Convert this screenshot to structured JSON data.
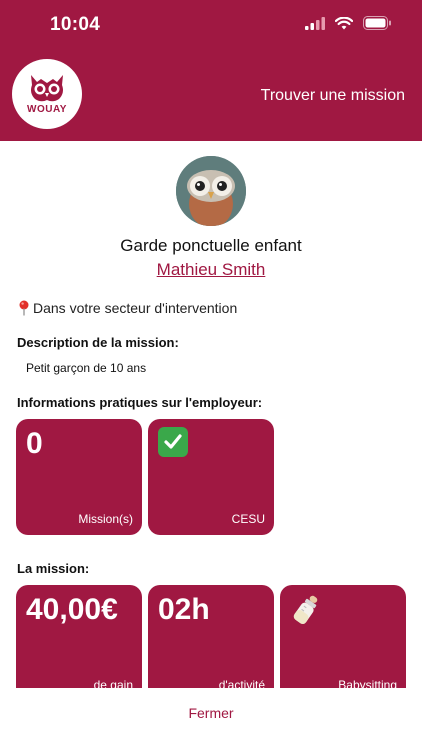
{
  "status_bar": {
    "time": "10:04"
  },
  "header": {
    "logo_text": "WOUAY",
    "find_mission": "Trouver une mission"
  },
  "mission": {
    "title": "Garde ponctuelle enfant",
    "employer": "Mathieu Smith",
    "location": "Dans votre secteur d'intervention",
    "description_heading": "Description de la mission:",
    "description": "Petit garçon de 10 ans",
    "employer_info_heading": "Informations pratiques sur l'employeur:",
    "employer_tiles": [
      {
        "value": "0",
        "caption": "Mission(s)"
      },
      {
        "value": "✅",
        "caption": "CESU"
      }
    ],
    "mission_heading": "La mission:",
    "mission_tiles": [
      {
        "value": "40,00€",
        "caption": "de gain"
      },
      {
        "value": "02h",
        "caption": "d'activité"
      },
      {
        "value": "🍼",
        "caption": "Babysitting"
      }
    ]
  },
  "footer": {
    "close_label": "Fermer"
  },
  "colors": {
    "brand": "#a01842"
  }
}
